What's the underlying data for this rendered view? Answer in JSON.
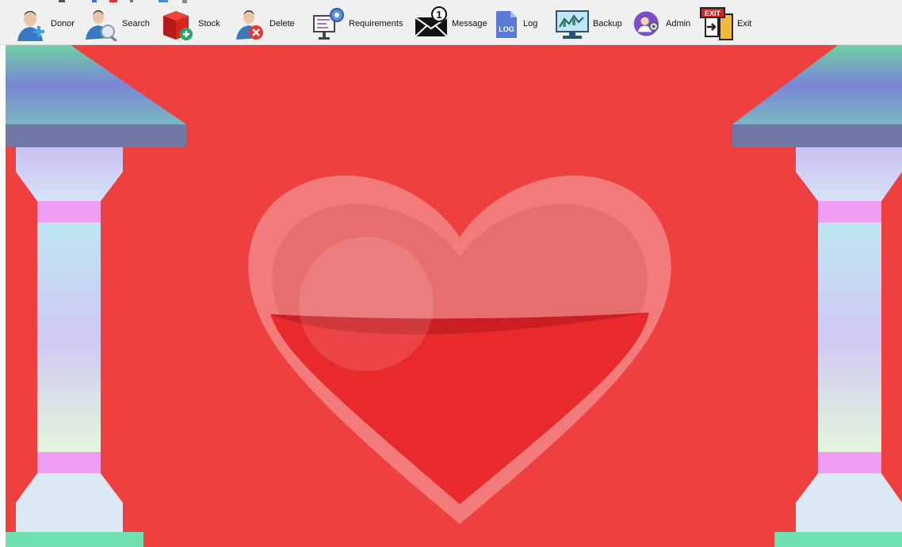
{
  "toolbar": {
    "buttons": [
      {
        "id": "donor",
        "label": "Donor",
        "icon": "donor-icon"
      },
      {
        "id": "search",
        "label": "Search",
        "icon": "search-icon"
      },
      {
        "id": "stock",
        "label": "Stock",
        "icon": "stock-icon"
      },
      {
        "id": "delete",
        "label": "Delete",
        "icon": "delete-icon"
      },
      {
        "id": "requirements",
        "label": "Requirements",
        "icon": "requirements-icon"
      },
      {
        "id": "message",
        "label": "Message",
        "icon": "message-icon",
        "badge": "1"
      },
      {
        "id": "log",
        "label": "Log",
        "icon": "log-icon",
        "icon_text": "LOG"
      },
      {
        "id": "backup",
        "label": "Backup",
        "icon": "backup-icon"
      },
      {
        "id": "admin",
        "label": "Admin",
        "icon": "admin-icon"
      },
      {
        "id": "exit",
        "label": "Exit",
        "icon": "exit-icon",
        "icon_text": "EXIT"
      }
    ]
  },
  "colors": {
    "background_red": "#ef4040",
    "heart_outline": "#f47b7b",
    "heart_fill": "#e92a2d",
    "pillar_top": "#c8c3f0",
    "pillar_band": "#ee9df2",
    "pillar_base_green": "#6fe0b0"
  }
}
